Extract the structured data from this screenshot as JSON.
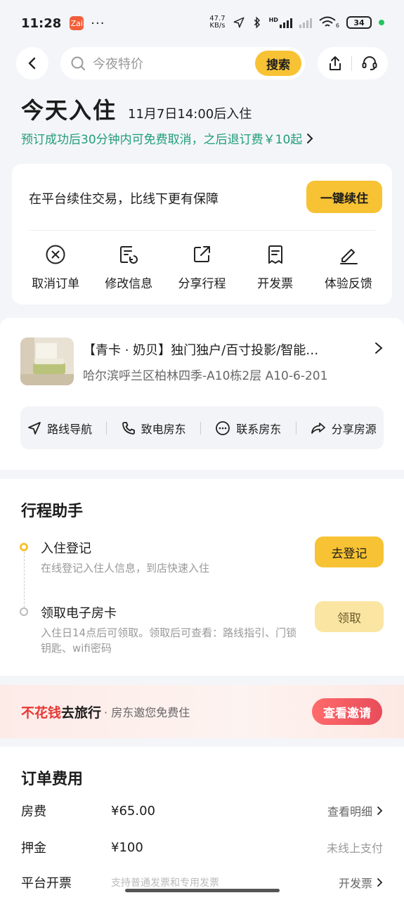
{
  "status_bar": {
    "time": "11:28",
    "app_badge": "Zai",
    "dots": "···",
    "net_speed_value": "47.7",
    "net_speed_unit": "KB/s",
    "hd_label": "HD",
    "wifi_sub": "6",
    "battery": "34"
  },
  "search": {
    "placeholder": "今夜特价",
    "button": "搜索"
  },
  "checkin": {
    "title": "今天入住",
    "subtitle": "11月7日14:00后入住",
    "cancel_policy": "预订成功后30分钟内可免费取消，之后退订费￥10起"
  },
  "renew_card": {
    "text": "在平台续住交易，比线下更有保障",
    "button": "一键续住",
    "actions": [
      {
        "label": "取消订单",
        "icon": "cancel-order-icon"
      },
      {
        "label": "修改信息",
        "icon": "edit-info-icon"
      },
      {
        "label": "分享行程",
        "icon": "share-trip-icon"
      },
      {
        "label": "开发票",
        "icon": "invoice-icon"
      },
      {
        "label": "体验反馈",
        "icon": "feedback-icon"
      }
    ]
  },
  "hotel": {
    "name": "【青卡 · 奶贝】独门独户/百寸投影/智能…",
    "address": "哈尔滨呼兰区柏林四季-A10栋2层 A10-6-201",
    "actions": [
      {
        "label": "路线导航",
        "icon": "navigation-icon"
      },
      {
        "label": "致电房东",
        "icon": "phone-icon"
      },
      {
        "label": "联系房东",
        "icon": "chat-icon"
      },
      {
        "label": "分享房源",
        "icon": "share-icon"
      }
    ]
  },
  "assistant": {
    "title": "行程助手",
    "steps": [
      {
        "title": "入住登记",
        "desc": "在线登记入住人信息，到店快速入住",
        "button": "去登记"
      },
      {
        "title": "领取电子房卡",
        "desc": "入住日14点后可领取。领取后可查看：路线指引、门锁钥匙、wifi密码",
        "button": "领取"
      }
    ]
  },
  "promo": {
    "red": "不花钱",
    "black": "去旅行",
    "sub": "· 房东邀您免费住",
    "button": "查看邀请"
  },
  "fees": {
    "title": "订单费用",
    "rows": [
      {
        "label": "房费",
        "value": "¥65.00",
        "right": "查看明细"
      },
      {
        "label": "押金",
        "value": "¥100",
        "right": "未线上支付"
      },
      {
        "label": "平台开票",
        "value": "支持普通发票和专用发票",
        "right": "开发票"
      }
    ]
  },
  "colors": {
    "accent": "#f7c233",
    "green": "#1f9d7a",
    "promo_red": "#e53935"
  }
}
